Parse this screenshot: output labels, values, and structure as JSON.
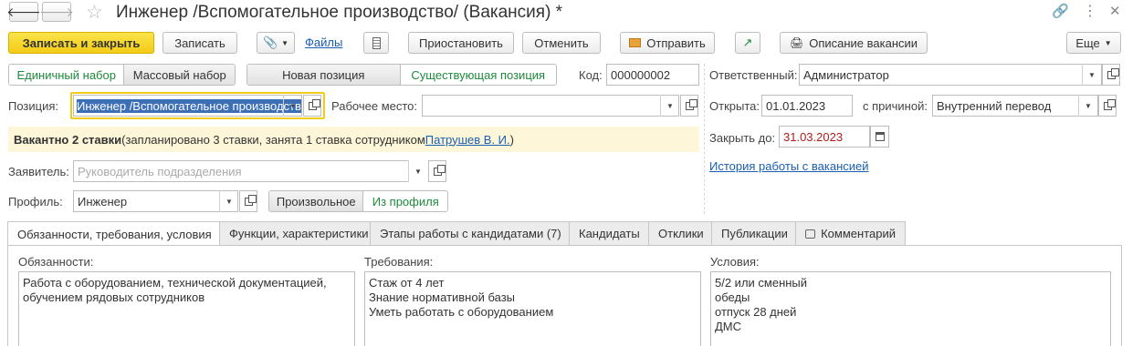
{
  "window": {
    "title": "Инженер /Вспомогательное производство/ (Вакансия) *"
  },
  "toolbar": {
    "save_close": "Записать и закрыть",
    "save": "Записать",
    "files": "Файлы",
    "suspend": "Приостановить",
    "cancel": "Отменить",
    "send": "Отправить",
    "description": "Описание вакансии",
    "more": "Еще"
  },
  "set_type": {
    "single": "Единичный набор",
    "mass": "Массовый набор"
  },
  "position_type": {
    "new": "Новая позиция",
    "existing": "Существующая позиция"
  },
  "code": {
    "label": "Код:",
    "value": "000000002"
  },
  "responsible": {
    "label": "Ответственный:",
    "value": "Администратор"
  },
  "position": {
    "label": "Позиция:",
    "value": "Инженер /Вспомогательное производство/"
  },
  "workplace": {
    "label": "Рабочее место:",
    "value": ""
  },
  "opened": {
    "label": "Открыта:",
    "value": "01.01.2023"
  },
  "reason": {
    "label": "с причиной:",
    "value": "Внутренний перевод"
  },
  "close_by": {
    "label": "Закрыть до:",
    "value": "31.03.2023"
  },
  "history_link": "История работы с вакансией",
  "info": {
    "bold": "Вакантно 2 ставки",
    "text": " (запланировано 3 ставки, занята 1 ставка сотрудником ",
    "employee": "Патрушев В. И.",
    "end": ")"
  },
  "applicant": {
    "label": "Заявитель:",
    "placeholder": "Руководитель подразделения"
  },
  "profile": {
    "label": "Профиль:",
    "value": "Инженер",
    "arbitrary": "Произвольное",
    "from_profile": "Из профиля"
  },
  "tabs": [
    "Обязанности, требования, условия",
    "Функции, характеристики",
    "Этапы работы с кандидатами (7)",
    "Кандидаты",
    "Отклики",
    "Публикации",
    "Комментарий"
  ],
  "duties": {
    "label": "Обязанности:",
    "lines": [
      "Работа с оборудованием, технической документацией,",
      "обучением рядовых сотрудников"
    ]
  },
  "requirements": {
    "label": "Требования:",
    "lines": [
      "Стаж от 4 лет",
      "Знание нормативной базы",
      "Уметь работать с оборудованием"
    ]
  },
  "conditions": {
    "label": "Условия:",
    "lines": [
      "5/2 или сменный",
      "обеды",
      "отпуск 28 дней",
      "ДМС"
    ]
  },
  "colors": {
    "accent": "#f2cc16",
    "link": "#1a5fb4",
    "green": "#1e8a3c",
    "info_bg": "#fdf6d8"
  }
}
